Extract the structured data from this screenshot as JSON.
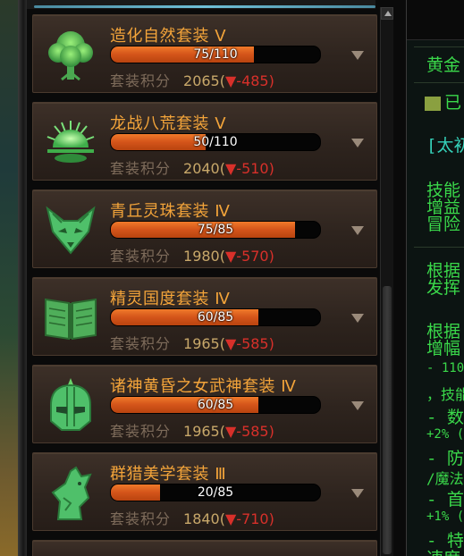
{
  "set_list": [
    {
      "name": "造化自然套装 Ⅴ",
      "progress_text": "75/110",
      "progress": 0.682,
      "score_label": "套装积分",
      "score": "2065",
      "diff_open": "(",
      "diff_arrow": "▼",
      "diff": "-485",
      "diff_close": ")",
      "icon": "tree-icon"
    },
    {
      "name": "龙战八荒套装 Ⅴ",
      "progress_text": "50/110",
      "progress": 0.455,
      "score_label": "套装积分",
      "score": "2040",
      "diff_open": "(",
      "diff_arrow": "▼",
      "diff": "-510",
      "diff_close": ")",
      "icon": "rising-sun-icon"
    },
    {
      "name": "青丘灵珠套装 Ⅳ",
      "progress_text": "75/85",
      "progress": 0.882,
      "score_label": "套装积分",
      "score": "1980",
      "diff_open": "(",
      "diff_arrow": "▼",
      "diff": "-570",
      "diff_close": ")",
      "icon": "fox-icon"
    },
    {
      "name": "精灵国度套装 Ⅳ",
      "progress_text": "60/85",
      "progress": 0.706,
      "score_label": "套装积分",
      "score": "1965",
      "diff_open": "(",
      "diff_arrow": "▼",
      "diff": "-585",
      "diff_close": ")",
      "icon": "book-icon"
    },
    {
      "name": "诸神黄昏之女武神套装 Ⅳ",
      "progress_text": "60/85",
      "progress": 0.706,
      "score_label": "套装积分",
      "score": "1965",
      "diff_open": "(",
      "diff_arrow": "▼",
      "diff": "-585",
      "diff_close": ")",
      "icon": "helmet-icon"
    },
    {
      "name": "群猎美学套装 Ⅲ",
      "progress_text": "20/85",
      "progress": 0.235,
      "score_label": "套装积分",
      "score": "1840",
      "diff_open": "(",
      "diff_arrow": "▼",
      "diff": "-710",
      "diff_close": ")",
      "icon": "wolf-icon"
    }
  ],
  "right_panel": {
    "lines": [
      "黄金",
      "已",
      "[太初",
      "技能",
      "增益",
      "冒险",
      "根据",
      "发挥",
      "根据",
      "增幅",
      "- 110",
      "，技能",
      "- 数",
      "+2% (",
      "- 防",
      "/魔法",
      "- 首",
      "+1% (",
      "- 特",
      "速度"
    ]
  },
  "colors": {
    "set_name": "#f3a43a",
    "bar_fill": "#d3541a",
    "score_value": "#c8a86a",
    "diff": "#d8302a",
    "icon_green": "#5fd36a"
  }
}
